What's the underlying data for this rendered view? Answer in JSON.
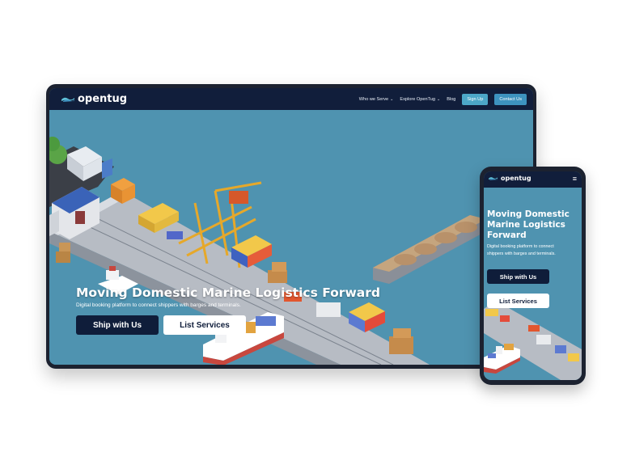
{
  "brand": {
    "name": "opentug"
  },
  "desktop": {
    "nav": {
      "who_we_serve": "Who we Serve",
      "explore": "Explore OpenTug",
      "blog": "Blog",
      "signup": "Sign Up",
      "contact": "Contact Us"
    },
    "hero": {
      "title": "Moving Domestic Marine Logistics Forward",
      "subtitle": "Digital booking platform to connect shippers with barges and terminals.",
      "primary_cta": "Ship with Us",
      "secondary_cta": "List Services"
    }
  },
  "mobile": {
    "hero": {
      "title": "Moving Domestic Marine Logistics Forward",
      "subtitle": "Digital booking platform to connect shippers with barges and terminals.",
      "primary_cta": "Ship with Us",
      "secondary_cta": "List Services"
    }
  },
  "icons": [
    "opentug-logo-icon",
    "chevron-down-icon",
    "hamburger-menu-icon"
  ],
  "colors": {
    "nav_bg": "#111e3b",
    "water": "#4f93b0",
    "accent": "#4ca7c7",
    "button_dark": "#0f1d3a"
  }
}
